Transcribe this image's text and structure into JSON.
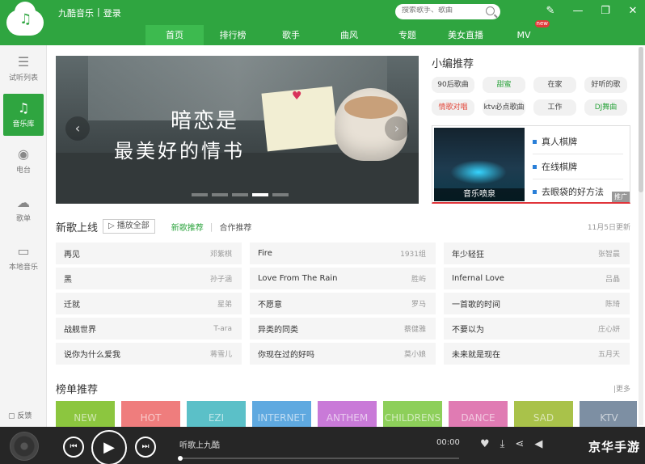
{
  "app": {
    "name": "九酷音乐",
    "separator": "|",
    "login": "登录",
    "search_placeholder": "搜索歌手、歌曲"
  },
  "window_controls": [
    "✎",
    "—",
    "❐",
    "✕"
  ],
  "nav": {
    "tabs": [
      {
        "label": "首页",
        "active": true
      },
      {
        "label": "排行榜"
      },
      {
        "label": "歌手"
      },
      {
        "label": "曲风"
      },
      {
        "label": "专题"
      },
      {
        "label": "美女直播"
      },
      {
        "label": "MV",
        "badge": "new"
      }
    ]
  },
  "sidebar": {
    "items": [
      {
        "label": "试听列表",
        "icon": "list-icon"
      },
      {
        "label": "音乐库",
        "icon": "music-note-icon",
        "active": true
      },
      {
        "label": "电台",
        "icon": "radio-icon"
      },
      {
        "label": "歌单",
        "icon": "cloud-icon"
      },
      {
        "label": "本地音乐",
        "icon": "monitor-icon"
      }
    ],
    "feedback": "反馈"
  },
  "banner": {
    "line1": "暗恋是",
    "line2": "最美好的情书",
    "slides": 5,
    "active_slide": 4
  },
  "editor_picks": {
    "title": "小编推荐",
    "tags": [
      {
        "label": "90后歌曲",
        "color": "normal"
      },
      {
        "label": "甜蜜",
        "color": "green"
      },
      {
        "label": "在家",
        "color": "normal"
      },
      {
        "label": "好听的歌",
        "color": "normal"
      },
      {
        "label": "情歌对唱",
        "color": "red"
      },
      {
        "label": "ktv必点歌曲",
        "color": "normal"
      },
      {
        "label": "工作",
        "color": "normal"
      },
      {
        "label": "DJ舞曲",
        "color": "green"
      }
    ],
    "feature_caption": "音乐喷泉",
    "links": [
      "真人棋牌",
      "在线棋牌",
      "去眼袋的好方法"
    ],
    "ad_label": "推广"
  },
  "new_songs": {
    "title": "新歌上线",
    "play_all": "播放全部",
    "subtabs": [
      {
        "label": "新歌推荐",
        "active": true
      },
      {
        "label": "合作推荐"
      }
    ],
    "date": "11月5日更新",
    "columns": [
      [
        {
          "title": "再见",
          "artist": "邓紫棋"
        },
        {
          "title": "黑",
          "artist": "孙子涵"
        },
        {
          "title": "迁就",
          "artist": "星弟"
        },
        {
          "title": "战舰世界",
          "artist": "T-ara"
        },
        {
          "title": "说你为什么爱我",
          "artist": "蒋雪儿"
        }
      ],
      [
        {
          "title": "Fire",
          "artist": "1931组"
        },
        {
          "title": "Love From The Rain",
          "artist": "胜屿"
        },
        {
          "title": "不愿意",
          "artist": "罗马"
        },
        {
          "title": "异类的同类",
          "artist": "蔡健雅"
        },
        {
          "title": "你现在过的好吗",
          "artist": "莫小娘"
        }
      ],
      [
        {
          "title": "年少轻狂",
          "artist": "张智晨"
        },
        {
          "title": "Infernal Love",
          "artist": "吕晶"
        },
        {
          "title": "一首歌的时间",
          "artist": "陈琦"
        },
        {
          "title": "不要以为",
          "artist": "庄心妍"
        },
        {
          "title": "未来就是现在",
          "artist": "五月天"
        }
      ]
    ]
  },
  "charts": {
    "title": "榜单推荐",
    "more": "更多",
    "cards": [
      {
        "label": "NEW",
        "color": "#8cc63f"
      },
      {
        "label": "HOT",
        "color": "#ef7d7d"
      },
      {
        "label": "EZI",
        "color": "#5bc0c8"
      },
      {
        "label": "INTERNET",
        "color": "#5fa9e0"
      },
      {
        "label": "ANTHEM",
        "color": "#c97ad8"
      },
      {
        "label": "CHILDRENS",
        "color": "#8dcf5a"
      },
      {
        "label": "DANCE",
        "color": "#e07bb3"
      },
      {
        "label": "SAD",
        "color": "#a9c24a"
      },
      {
        "label": "KTV",
        "color": "#7d8fa3"
      }
    ]
  },
  "player": {
    "now_playing": "听歌上九酷",
    "time": "00:00",
    "progress": 0
  },
  "watermark": "京华手游",
  "colors": {
    "brand": "#2fa540",
    "accent_red": "#e0343a"
  }
}
